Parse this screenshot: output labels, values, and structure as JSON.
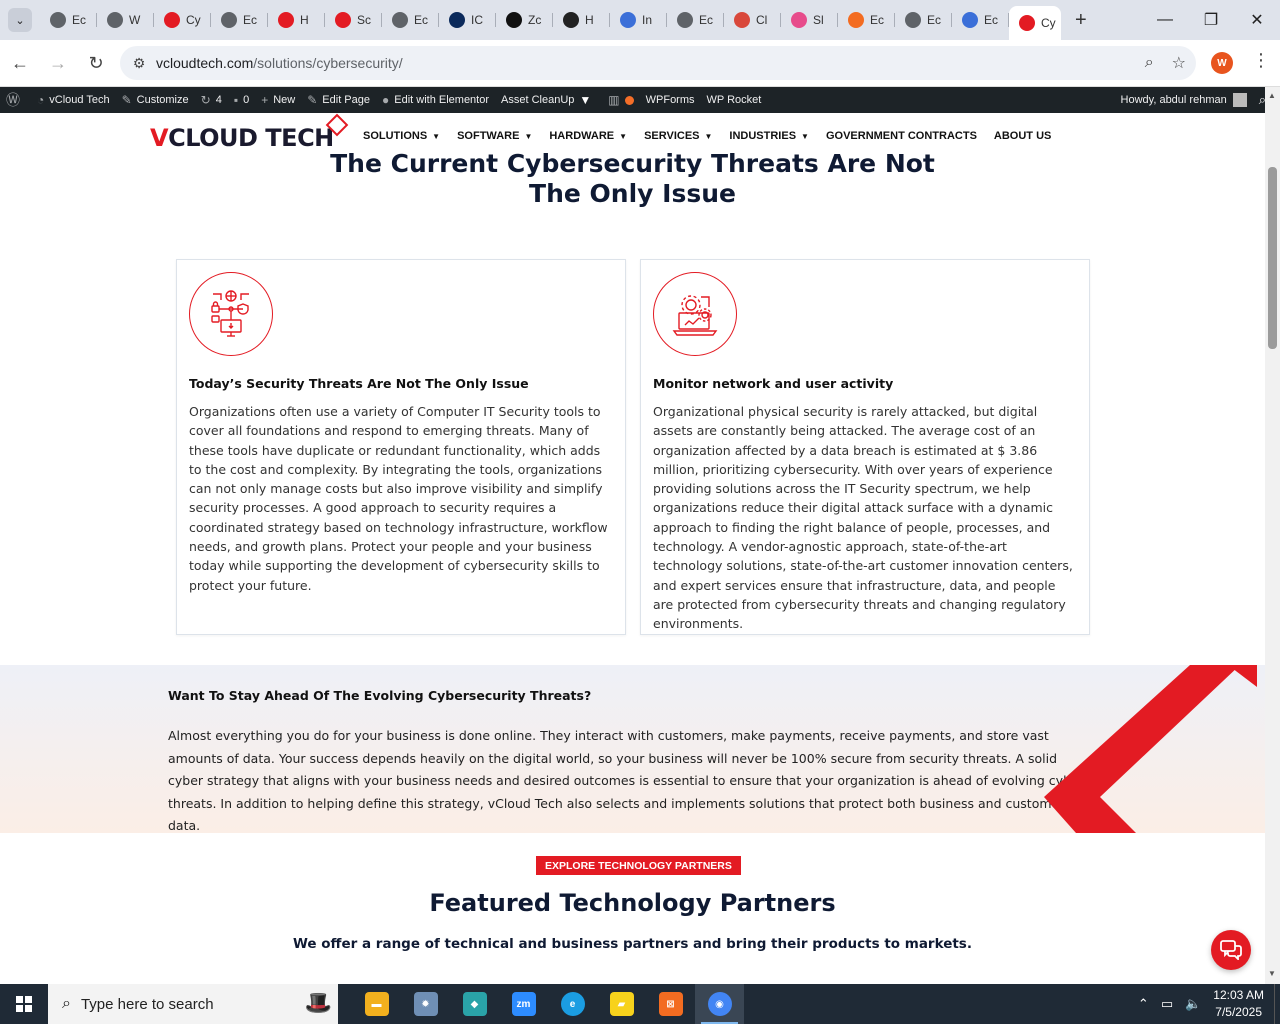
{
  "browser": {
    "tabs": [
      {
        "label": "Ec",
        "color": "#5f6368"
      },
      {
        "label": "W",
        "color": "#5f6368"
      },
      {
        "label": "Cy",
        "color": "#e31b23"
      },
      {
        "label": "Ec",
        "color": "#5f6368"
      },
      {
        "label": "H",
        "color": "#e31b23"
      },
      {
        "label": "Sc",
        "color": "#e31b23"
      },
      {
        "label": "Ec",
        "color": "#5f6368"
      },
      {
        "label": "IC",
        "color": "#0b2a5b"
      },
      {
        "label": "Zc",
        "color": "#111111"
      },
      {
        "label": "H",
        "color": "#222222"
      },
      {
        "label": "In",
        "color": "#3b6fd8"
      },
      {
        "label": "Ec",
        "color": "#5f6368"
      },
      {
        "label": "Cl",
        "color": "#d9483b"
      },
      {
        "label": "Sl",
        "color": "#e74c8b"
      },
      {
        "label": "Ec",
        "color": "#f36c21"
      },
      {
        "label": "Ec",
        "color": "#5f6368"
      },
      {
        "label": "Ec",
        "color": "#3b6fd8"
      }
    ],
    "active_tab": {
      "label": "Cy"
    },
    "url_host": "vcloudtech.com",
    "url_path": "/solutions/cybersecurity/",
    "profile_initial": "W"
  },
  "adminbar": {
    "site": "vCloud Tech",
    "customize": "Customize",
    "updates": "4",
    "comments": "0",
    "new": "New",
    "edit_page": "Edit Page",
    "elementor": "Edit with Elementor",
    "asset_cleanup": "Asset CleanUp",
    "wpforms": "WPForms",
    "wprocket": "WP Rocket",
    "howdy": "Howdy, abdul rehman"
  },
  "site": {
    "logo_v": "V",
    "logo_rest": "CLOUD TECH",
    "nav": [
      {
        "label": "SOLUTIONS",
        "caret": true
      },
      {
        "label": "SOFTWARE",
        "caret": true
      },
      {
        "label": "HARDWARE",
        "caret": true
      },
      {
        "label": "SERVICES",
        "caret": true
      },
      {
        "label": "INDUSTRIES",
        "caret": true
      },
      {
        "label": "GOVERNMENT CONTRACTS",
        "caret": false
      },
      {
        "label": "ABOUT US",
        "caret": false
      }
    ]
  },
  "section": {
    "title_line1": "The Current Cybersecurity Threats Are Not",
    "title_line2": "The Only Issue"
  },
  "cards": [
    {
      "title": "Today’s Security Threats Are Not The Only Issue",
      "body": "Organizations often use a variety of Computer IT Security tools to cover all foundations and respond to emerging threats. Many of these tools have duplicate or redundant functionality, which adds to the cost and complexity. By integrating the tools, organizations can not only manage costs but also improve visibility and simplify security processes. A good approach to security requires a coordinated strategy based on technology infrastructure, workflow needs, and growth plans. Protect your people and your business today while supporting the development of cybersecurity skills to protect your future."
    },
    {
      "title": "Monitor network and user activity",
      "body": "Organizational physical security is rarely attacked, but digital assets are constantly being attacked. The average cost of an organization affected by a data breach is estimated at $ 3.86 million, prioritizing cybersecurity. With over years of experience providing solutions across the IT Security spectrum, we help organizations reduce their digital attack surface with a dynamic approach to finding the right balance of people, processes, and technology. A vendor-agnostic approach, state-of-the-art technology solutions, state-of-the-art customer innovation centers, and expert services ensure that infrastructure, data, and people are protected from cybersecurity threats and changing regulatory environments."
    }
  ],
  "band": {
    "heading": "Want To Stay Ahead Of The Evolving Cybersecurity Threats?",
    "body": "Almost everything you do for your business is done online. They interact with customers, make payments, receive payments, and store vast amounts of data. Your success depends heavily on the digital world, so your business will never be 100% secure from security threats. A solid cyber strategy that aligns with your business needs and desired outcomes is essential to ensure that your organization is ahead of evolving cyber threats. In addition to helping define this strategy, vCloud Tech also selects and implements solutions that protect both business and customer data."
  },
  "partners": {
    "pill": "EXPLORE TECHNOLOGY PARTNERS",
    "title": "Featured Technology Partners",
    "subtitle": "We offer a range of technical and business partners and bring their products to markets."
  },
  "taskbar": {
    "search_placeholder": "Type here to search",
    "apps": [
      {
        "name": "file-explorer",
        "color": "#f2b01e",
        "glyph": "▬"
      },
      {
        "name": "app-2",
        "color": "#6f8fb5",
        "glyph": "✹"
      },
      {
        "name": "app-3",
        "color": "#2aa3a8",
        "glyph": "◆"
      },
      {
        "name": "zoom",
        "color": "#2d8cff",
        "glyph": "zm"
      },
      {
        "name": "edge",
        "color": "#1b9de2",
        "glyph": "e"
      },
      {
        "name": "sticky-notes",
        "color": "#f7d21c",
        "glyph": "▰"
      },
      {
        "name": "xampp",
        "color": "#f36c21",
        "glyph": "⊠"
      },
      {
        "name": "chrome",
        "color": "#4285f4",
        "glyph": "◉"
      }
    ],
    "time": "12:03 AM",
    "date": "7/5/2025"
  },
  "colors": {
    "brand_red": "#e31b23",
    "navy": "#0f1a33"
  }
}
